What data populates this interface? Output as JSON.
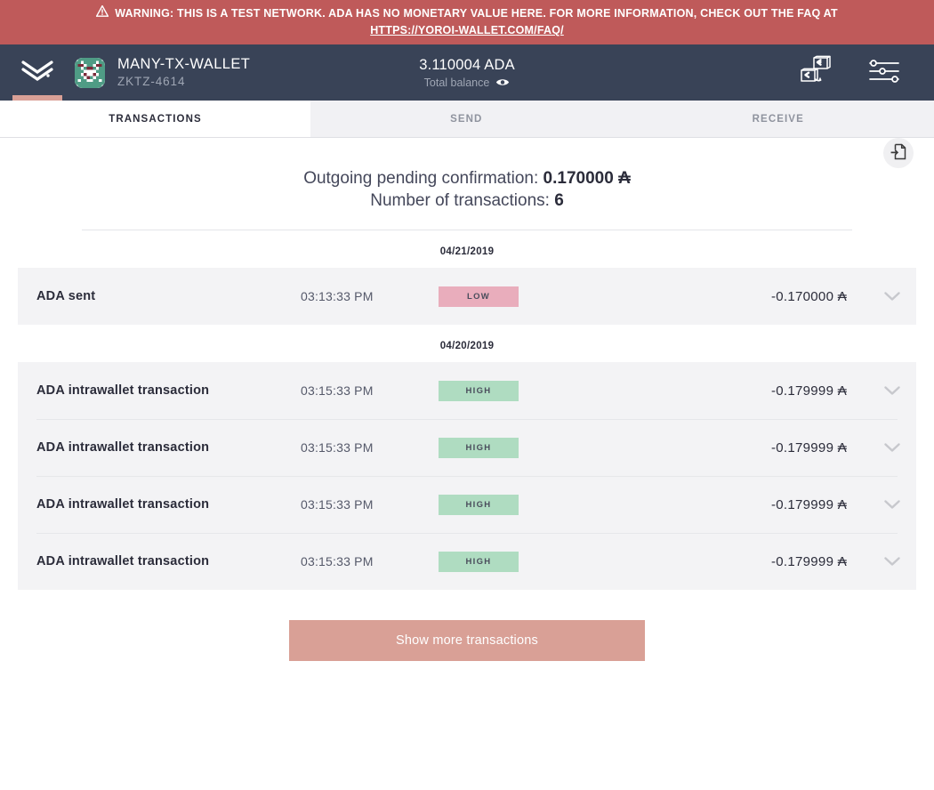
{
  "banner": {
    "icon": "warning-triangle-icon",
    "line1": "WARNING: THIS IS A TEST NETWORK. ADA HAS NO MONETARY VALUE HERE. FOR MORE INFORMATION, CHECK OUT THE FAQ AT",
    "link_text": "HTTPS://YOROI-WALLET.COM/FAQ/",
    "bg_color": "#bf5a5a",
    "text_color": "#ffffff"
  },
  "navbar": {
    "logo_icon": "yoroi-logo-icon",
    "wallet_avatar_icon": "wallet-identicon",
    "wallet_name": "MANY-TX-WALLET",
    "wallet_plate": "ZKTZ-4614",
    "balance_amount": "3.110004 ADA",
    "balance_label": "Total balance",
    "balance_visibility_icon": "eye-icon",
    "wallet_switch_icon": "wallet-switch-icon",
    "settings_icon": "settings-sliders-icon",
    "bg_color": "#394357",
    "accent_color": "#d9a096"
  },
  "tabs": [
    {
      "id": "transactions",
      "label": "TRANSACTIONS",
      "active": true
    },
    {
      "id": "send",
      "label": "SEND",
      "active": false
    },
    {
      "id": "receive",
      "label": "RECEIVE",
      "active": false
    }
  ],
  "summary": {
    "pending_prefix": "Outgoing pending confirmation:",
    "pending_amount": "0.170000",
    "currency_symbol": "₳",
    "count_prefix": "Number of transactions:",
    "count_value": "6",
    "export_icon": "export-transactions-icon"
  },
  "groups": [
    {
      "date": "04/21/2019",
      "rows": [
        {
          "type": "ADA sent",
          "time": "03:13:33 PM",
          "status": "LOW",
          "status_kind": "low",
          "amount": "-0.170000",
          "currency_symbol": "₳",
          "chevron_icon": "chevron-down-icon"
        }
      ]
    },
    {
      "date": "04/20/2019",
      "rows": [
        {
          "type": "ADA intrawallet transaction",
          "time": "03:15:33 PM",
          "status": "HIGH",
          "status_kind": "high",
          "amount": "-0.179999",
          "currency_symbol": "₳",
          "chevron_icon": "chevron-down-icon"
        },
        {
          "type": "ADA intrawallet transaction",
          "time": "03:15:33 PM",
          "status": "HIGH",
          "status_kind": "high",
          "amount": "-0.179999",
          "currency_symbol": "₳",
          "chevron_icon": "chevron-down-icon"
        },
        {
          "type": "ADA intrawallet transaction",
          "time": "03:15:33 PM",
          "status": "HIGH",
          "status_kind": "high",
          "amount": "-0.179999",
          "currency_symbol": "₳",
          "chevron_icon": "chevron-down-icon"
        },
        {
          "type": "ADA intrawallet transaction",
          "time": "03:15:33 PM",
          "status": "HIGH",
          "status_kind": "high",
          "amount": "-0.179999",
          "currency_symbol": "₳",
          "chevron_icon": "chevron-down-icon"
        }
      ]
    }
  ],
  "footer": {
    "show_more_label": "Show more transactions",
    "show_more_color": "#d9a096"
  },
  "colors": {
    "badge_low_bg": "#e9adbc",
    "badge_high_bg": "#afdcc1",
    "row_bg": "#f3f3f5"
  }
}
